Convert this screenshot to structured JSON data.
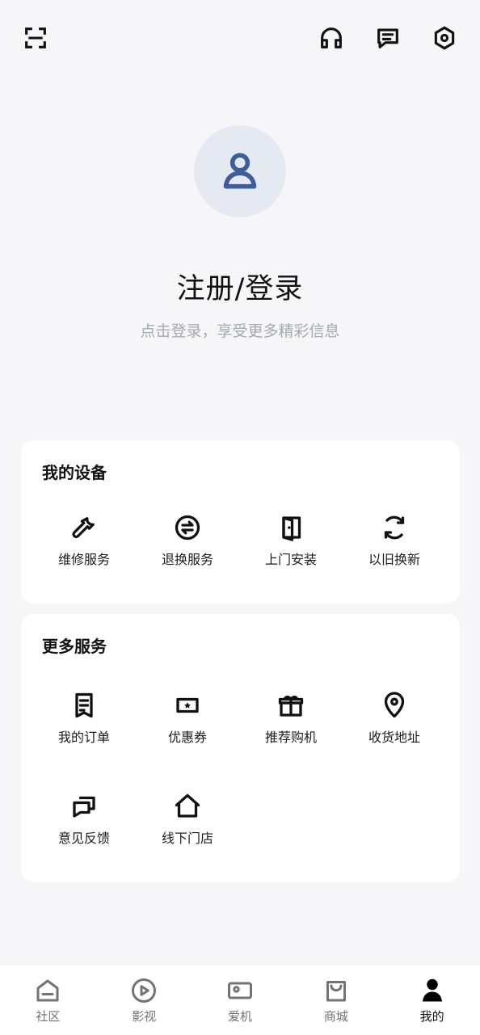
{
  "colors": {
    "background": "#f6f6f9",
    "card": "#ffffff",
    "avatar_bg": "#e5e9f2",
    "avatar_icon": "#3d5d9c",
    "primary_text": "#111111",
    "secondary_text": "#a7a8ad",
    "nav_inactive": "#737373"
  },
  "top_bar": {
    "icons": [
      {
        "name": "scan-icon"
      },
      {
        "name": "headset-icon"
      },
      {
        "name": "message-icon"
      },
      {
        "name": "settings-icon"
      }
    ]
  },
  "profile": {
    "avatar_icon": "user-icon",
    "title": "注册/登录",
    "subtitle": "点击登录，享受更多精彩信息"
  },
  "devices": {
    "title": "我的设备",
    "items": [
      {
        "label": "维修服务",
        "icon": "wrench-icon"
      },
      {
        "label": "退换服务",
        "icon": "exchange-icon"
      },
      {
        "label": "上门安装",
        "icon": "door-icon"
      },
      {
        "label": "以旧换新",
        "icon": "refresh-icon"
      }
    ]
  },
  "more_services": {
    "title": "更多服务",
    "items": [
      {
        "label": "我的订单",
        "icon": "order-icon"
      },
      {
        "label": "优惠券",
        "icon": "coupon-icon"
      },
      {
        "label": "推荐购机",
        "icon": "gift-icon"
      },
      {
        "label": "收货地址",
        "icon": "location-icon"
      },
      {
        "label": "意见反馈",
        "icon": "feedback-icon"
      },
      {
        "label": "线下门店",
        "icon": "store-icon"
      }
    ]
  },
  "bottom_nav": {
    "items": [
      {
        "label": "社区",
        "icon": "home-icon"
      },
      {
        "label": "影视",
        "icon": "play-icon"
      },
      {
        "label": "爱机",
        "icon": "device-icon"
      },
      {
        "label": "商城",
        "icon": "shopping-bag-icon"
      },
      {
        "label": "我的",
        "icon": "profile-icon",
        "active": true
      }
    ]
  }
}
